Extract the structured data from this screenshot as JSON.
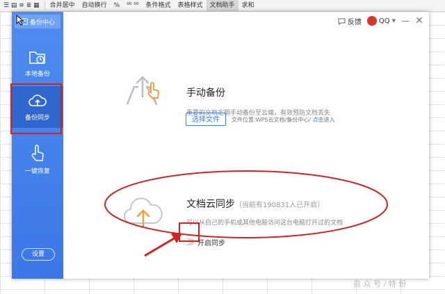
{
  "ribbon": {
    "items": [
      "合并居中",
      "自动换行",
      "%",
      "条件格式",
      "表格样式",
      "文档助手",
      "求和"
    ]
  },
  "sidebar": {
    "title": "备份中心",
    "items": [
      {
        "label": "本地备份"
      },
      {
        "label": "备份同步"
      },
      {
        "label": "一键恢复"
      }
    ],
    "settings_label": "设置"
  },
  "topbar": {
    "feedback": "反馈",
    "account": "QQ"
  },
  "manual": {
    "title": "手动备份",
    "desc": "重要的文档定期手动备份至云端，有效预防文档丢失",
    "button": "选择文件",
    "file_location": "文件位置:WPS云文档/备份中心/",
    "enter_link": "点击进入"
  },
  "cloud": {
    "title": "文档云同步",
    "note": "（当前有190831人已开启）",
    "desc": "可以从自己的手机或其他电脑访问这台电脑打开过的文档",
    "toggle_label": "开启同步",
    "toggle_on": false
  },
  "watermark": "自 众 号 / 特 份"
}
